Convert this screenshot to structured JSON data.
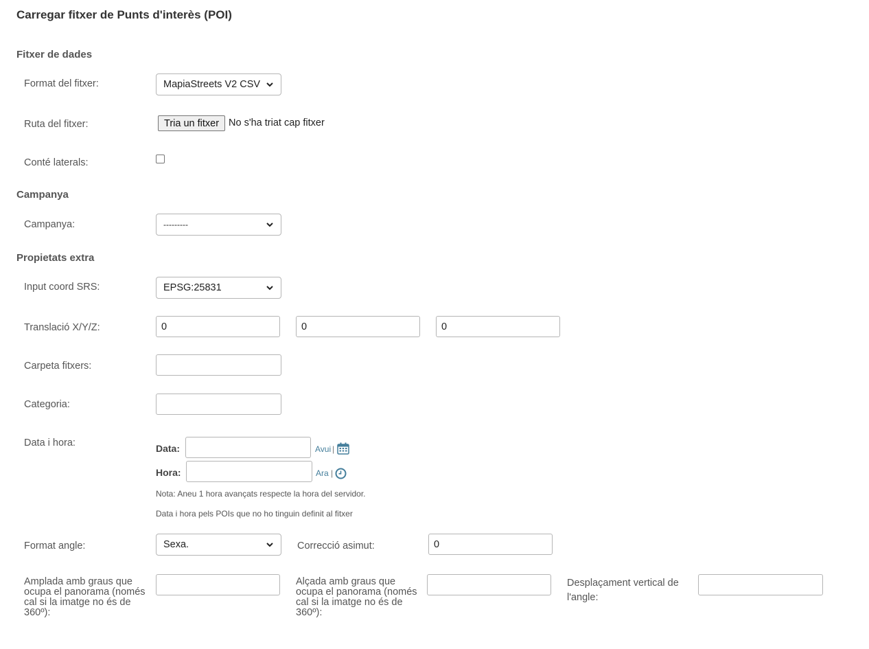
{
  "page_title": "Carregar fitxer de Punts d'interès (POI)",
  "sections": {
    "data_file": "Fitxer de dades",
    "campaign": "Campanya",
    "extra": "Propietats extra"
  },
  "fields": {
    "format_label": "Format del fitxer:",
    "format_value": "MapiaStreets V2 CSV",
    "path_label": "Ruta del fitxer:",
    "file_button": "Tria un fitxer",
    "file_status": "No s'ha triat cap fitxer",
    "laterals_label": "Conté laterals:",
    "laterals_checked": false,
    "campaign_label": "Campanya:",
    "campaign_value": "---------",
    "srs_label": "Input coord SRS:",
    "srs_value": "EPSG:25831",
    "translation_label": "Translació X/Y/Z:",
    "translation_x": "0",
    "translation_y": "0",
    "translation_z": "0",
    "folder_label": "Carpeta fitxers:",
    "folder_value": "",
    "category_label": "Categoria:",
    "category_value": "",
    "datetime_label": "Data i hora:",
    "date_label": "Data:",
    "date_value": "",
    "today_link": "Avui",
    "time_label": "Hora:",
    "time_value": "",
    "now_link": "Ara",
    "separator": "|",
    "note_timezone": "Nota: Aneu 1 hora avançats respecte la hora del servidor.",
    "note_datetime": "Data i hora pels POIs que no ho tinguin definit al fitxer",
    "angle_format_label": "Format angle:",
    "angle_format_value": "Sexa.",
    "azimuth_label": "Correcció asimut:",
    "azimuth_value": "0",
    "width_label": "Amplada amb graus que ocupa el panorama (només cal si la imatge no és de 360º):",
    "width_value": "",
    "height_label": "Alçada amb graus que ocupa el panorama (només cal si la imatge no és de 360º):",
    "height_value": "",
    "vertical_label": "Desplaçament vertical de l'angle:",
    "vertical_value": ""
  },
  "colors": {
    "link": "#447e9b",
    "icon": "#447e9b"
  },
  "icons": [
    "chevron-down-icon",
    "calendar-icon",
    "clock-icon"
  ]
}
